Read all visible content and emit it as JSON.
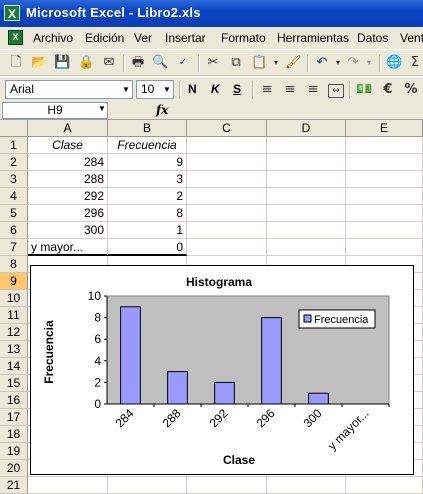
{
  "window": {
    "title": "Microsoft Excel - Libro2.xls",
    "app_icon": "X"
  },
  "menu": [
    "Archivo",
    "Edición",
    "Ver",
    "Insertar",
    "Formato",
    "Herramientas",
    "Datos",
    "Vent"
  ],
  "format_bar": {
    "font": "Arial",
    "size": "10",
    "bold": "N",
    "italic": "K",
    "underline": "S"
  },
  "name_box": "H9",
  "fx_label": "fx",
  "columns": [
    "A",
    "B",
    "C",
    "D",
    "E"
  ],
  "rows": [
    "1",
    "2",
    "3",
    "4",
    "5",
    "6",
    "7",
    "8",
    "9",
    "10",
    "11",
    "12",
    "13",
    "14",
    "15",
    "16",
    "17",
    "18",
    "19",
    "20",
    "21"
  ],
  "selected_row": "9",
  "table": {
    "headers": [
      "Clase",
      "Frecuencia"
    ],
    "rows": [
      {
        "clase": "284",
        "frecuencia": "9"
      },
      {
        "clase": "288",
        "frecuencia": "3"
      },
      {
        "clase": "292",
        "frecuencia": "2"
      },
      {
        "clase": "296",
        "frecuencia": "8"
      },
      {
        "clase": "300",
        "frecuencia": "1"
      },
      {
        "clase": "y mayor...",
        "frecuencia": "0"
      }
    ]
  },
  "chart_data": {
    "type": "bar",
    "title": "Histograma",
    "xlabel": "Clase",
    "ylabel": "Frecuencia",
    "categories": [
      "284",
      "288",
      "292",
      "296",
      "300",
      "y mayor..."
    ],
    "series": [
      {
        "name": "Frecuencia",
        "values": [
          9,
          3,
          2,
          8,
          1,
          0
        ]
      }
    ],
    "ylim": [
      0,
      10
    ],
    "yticks": [
      "0",
      "2",
      "4",
      "6",
      "8",
      "10"
    ],
    "legend": "right",
    "plot_bg": "#c0c0c0",
    "bar_color": "#9999ff"
  }
}
